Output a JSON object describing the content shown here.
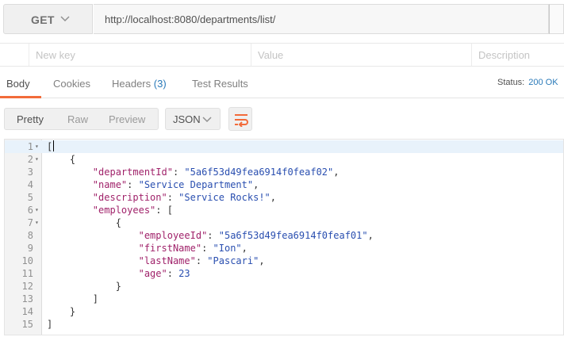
{
  "request": {
    "method": "GET",
    "url": "http://localhost:8080/departments/list/"
  },
  "params": {
    "key_placeholder": "New key",
    "value_placeholder": "Value",
    "description_placeholder": "Description"
  },
  "tabs": {
    "body": "Body",
    "cookies": "Cookies",
    "headers": "Headers",
    "headers_count": "(3)",
    "test_results": "Test Results"
  },
  "status": {
    "label": "Status:",
    "value": "200 OK"
  },
  "toolbar": {
    "pretty": "Pretty",
    "raw": "Raw",
    "preview": "Preview",
    "language": "JSON"
  },
  "colors": {
    "accent": "#f26b3a",
    "link_blue": "#2a7ab9",
    "json_key": "#a0226a",
    "json_string": "#2a4fb0"
  },
  "code": {
    "line_numbers": [
      "1",
      "2",
      "3",
      "4",
      "5",
      "6",
      "7",
      "8",
      "9",
      "10",
      "11",
      "12",
      "13",
      "14",
      "15"
    ],
    "department_id_key": "\"departmentId\"",
    "department_id_value": "\"5a6f53d49fea6914f0feaf02\"",
    "name_key": "\"name\"",
    "name_value": "\"Service Department\"",
    "description_key": "\"description\"",
    "description_value": "\"Service Rocks!\"",
    "employees_key": "\"employees\"",
    "employee_id_key": "\"employeeId\"",
    "employee_id_value": "\"5a6f53d49fea6914f0feaf01\"",
    "first_name_key": "\"firstName\"",
    "first_name_value": "\"Ion\"",
    "last_name_key": "\"lastName\"",
    "last_name_value": "\"Pascari\"",
    "age_key": "\"age\"",
    "age_value": "23"
  }
}
